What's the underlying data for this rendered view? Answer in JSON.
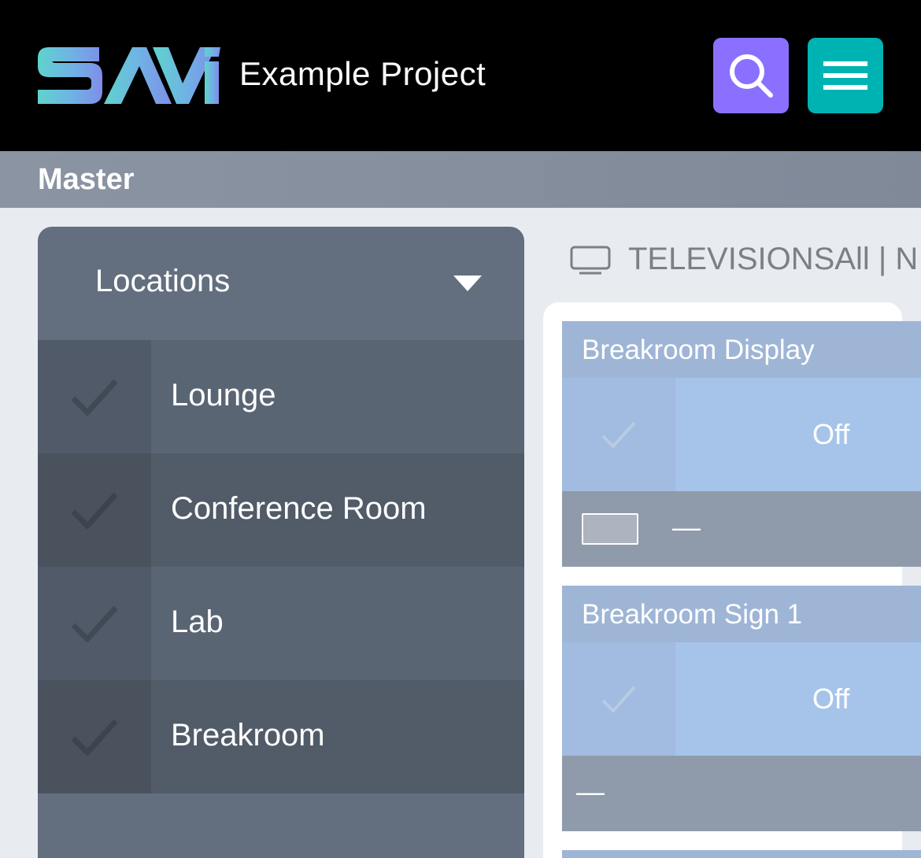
{
  "header": {
    "logo_text": "SAVi",
    "project_title": "Example Project",
    "search_icon": "search-icon",
    "menu_icon": "hamburger-menu-icon",
    "colors": {
      "search_button": "#8b70ff",
      "menu_button": "#00b3b3"
    }
  },
  "master": {
    "title": "Master"
  },
  "sidebar": {
    "title": "Locations",
    "items": [
      {
        "label": "Lounge"
      },
      {
        "label": "Conference Room"
      },
      {
        "label": "Lab"
      },
      {
        "label": "Breakroom"
      }
    ]
  },
  "section": {
    "icon": "television-icon",
    "title": "TELEVISIONSAll | N"
  },
  "cards": [
    {
      "title": "Breakroom Display",
      "state": "Off",
      "footer_value": "—"
    },
    {
      "title": "Breakroom Sign 1",
      "state": "Off",
      "footer_value": "—"
    }
  ]
}
